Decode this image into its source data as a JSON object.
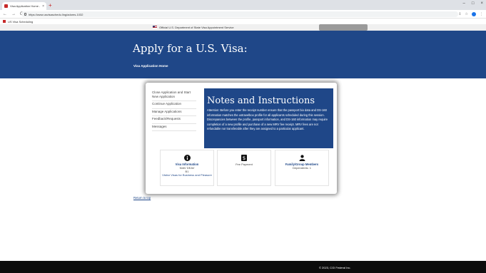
{
  "browser": {
    "tab_title": "Visa Application Home - Custo",
    "tab_close": "×",
    "new_tab": "+",
    "window_controls": [
      "–",
      "□",
      "×"
    ],
    "nav": [
      "←",
      "→",
      "C"
    ],
    "url": "https://www.usvisaschedu.ling/adoms-1032",
    "bookmark": "US Visa Scheduling",
    "toolbar_icons": [
      "⇩",
      "☆",
      "⋮"
    ]
  },
  "site": {
    "official_banner": "Official U.S. Department of State Visa Appointment Service",
    "title": "Apply for a U.S. Visa:",
    "breadcrumb": "Visa Application Home"
  },
  "sidebar": {
    "items": [
      "Close Application and Start New Application",
      "Continue Application",
      "Manage Applications",
      "Feedback/Requests",
      "Messages"
    ]
  },
  "notes": {
    "heading": "Notes and Instructions",
    "body": "Attention: Before you enter the receipt number ensure that the passport bio data and DS-160 information matches the ustravelbox profile for all applicants scheduled during this session. Discrepancies between the profile, passport information, and DS-160 information may require completion of a new profile and purchase of a new MRV fee receipt. MRV fees are not refundable nor transferable after they are assigned to a particular applicant."
  },
  "cards": [
    {
      "icon": "info-icon",
      "title": "Visa Information",
      "line1": "NIAV DEAV",
      "line2": "B1",
      "link": "Visitor Visas for Business and Pleasure"
    },
    {
      "icon": "dollar-icon",
      "title": "",
      "line1": "Fee Payment",
      "line2": "",
      "link": ""
    },
    {
      "icon": "person-icon",
      "title": "Family/Group Members",
      "line1": "Dependents: 1",
      "line2": "",
      "link": ""
    }
  ],
  "return_link": "Return to top",
  "footer": {
    "copyright": "© 2023, CGI Federal Inc."
  },
  "colors": {
    "brand_blue": "#1f4788",
    "footer": "#0c0c0c"
  }
}
